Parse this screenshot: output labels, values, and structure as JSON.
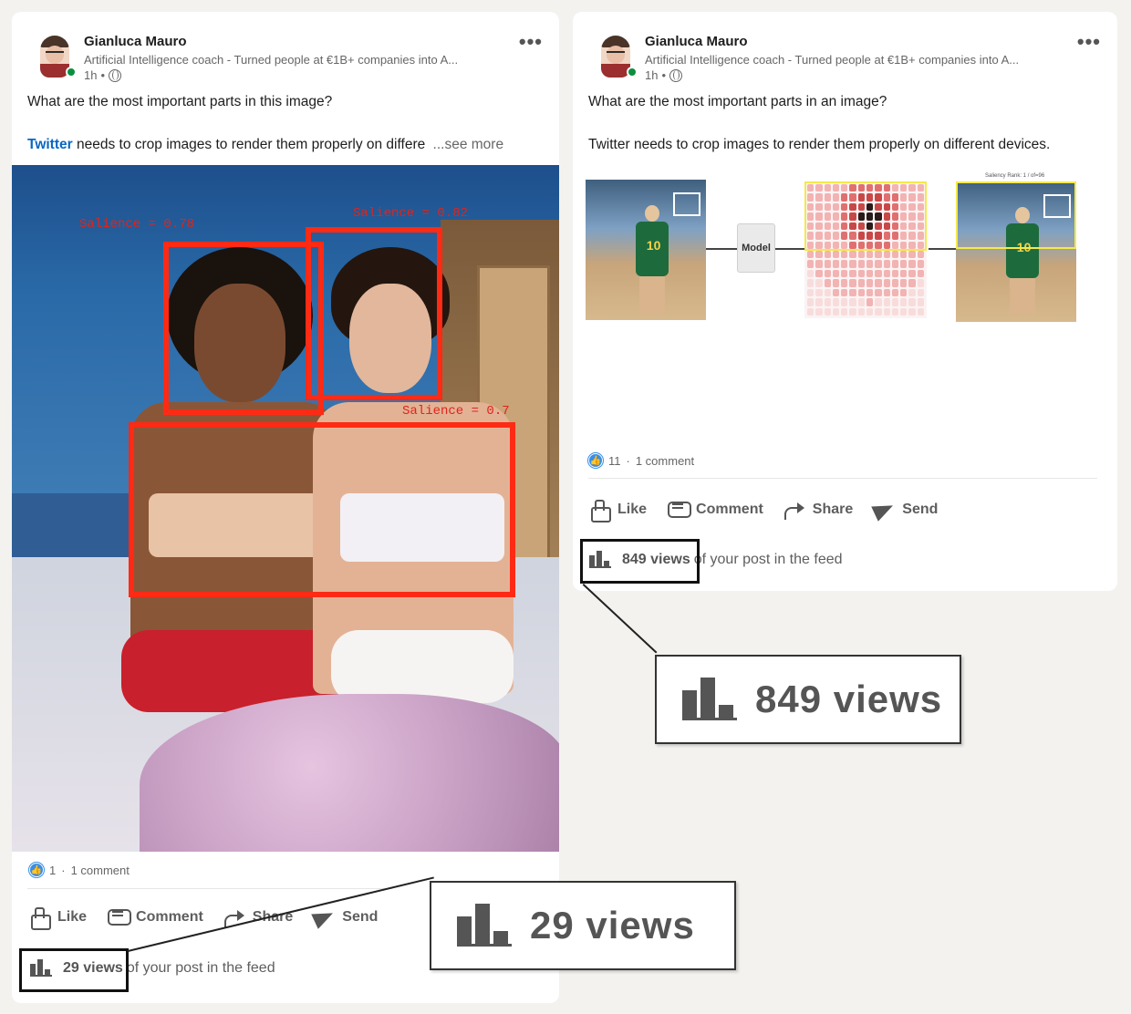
{
  "left_post": {
    "author": {
      "name": "Gianluca Mauro",
      "headline": "Artificial Intelligence coach - Turned people at €1B+ companies into A...",
      "time": "1h",
      "separator": "•"
    },
    "text_line1": "What are the most important parts in this image?",
    "hashtag": "Twitter",
    "text_line2": "needs to crop images to render them properly on differe",
    "see_more": "...see more",
    "image_labels": {
      "salience_1": "Salience = 0.78",
      "salience_2": "Salience = 0.82",
      "salience_3": "Salience = 0.7"
    },
    "reactions": {
      "count": "1",
      "dot": "·",
      "comments": "1 comment"
    },
    "actions": [
      "Like",
      "Comment",
      "Share",
      "Send"
    ],
    "views": {
      "count_label": "29 views",
      "suffix": "of your post in the feed"
    },
    "zoom_label": "29 views"
  },
  "right_post": {
    "author": {
      "name": "Gianluca Mauro",
      "headline": "Artificial Intelligence coach - Turned people at €1B+ companies into A...",
      "time": "1h",
      "separator": "•"
    },
    "text_line1": "What are the most important parts in an image?",
    "text_line2": "Twitter needs to crop images to render them properly on different devices.",
    "diagram": {
      "model_label": "Model",
      "tiny_label": "Saliency Rank: 1 / of=96",
      "jersey_number": "10"
    },
    "reactions": {
      "count": "11",
      "dot": "·",
      "comments": "1 comment"
    },
    "actions": [
      "Like",
      "Comment",
      "Share",
      "Send"
    ],
    "views": {
      "count_label": "849 views",
      "suffix": "of your post in the feed"
    },
    "zoom_label": "849 views"
  },
  "more_menu_glyph": "•••",
  "colors": {
    "page_bg": "#f3f2ef",
    "card_bg": "#ffffff",
    "link_blue": "#0a66c2",
    "salience_red": "#ff2a14",
    "online_green": "#0a8f40",
    "reaction_blue": "#378fe9"
  }
}
